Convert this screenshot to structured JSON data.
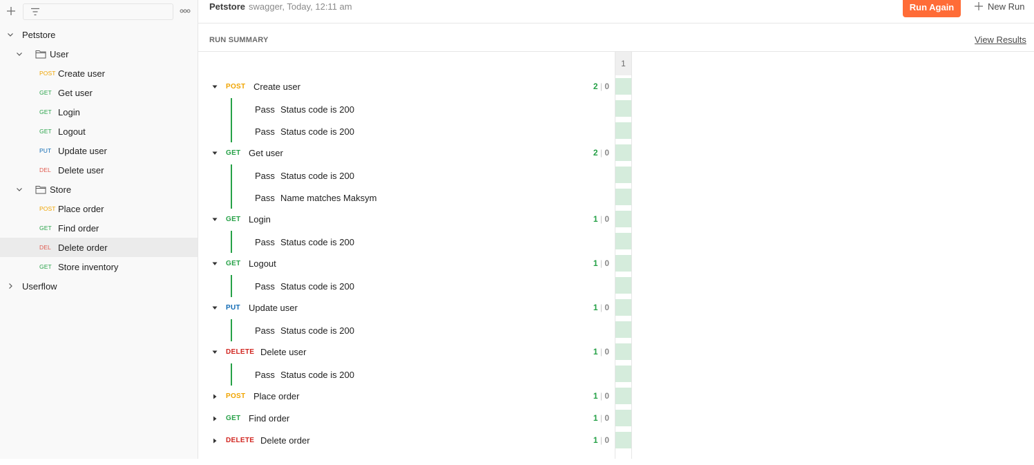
{
  "sidebar": {
    "icons": {
      "add": "plus-icon",
      "filter": "filter-icon",
      "more": "more-horizontal-icon"
    },
    "tree": [
      {
        "type": "collection",
        "label": "Petstore",
        "expanded": true
      },
      {
        "type": "folder",
        "label": "User",
        "expanded": true
      },
      {
        "type": "request",
        "method": "POST",
        "label": "Create user"
      },
      {
        "type": "request",
        "method": "GET",
        "label": "Get user"
      },
      {
        "type": "request",
        "method": "GET",
        "label": "Login"
      },
      {
        "type": "request",
        "method": "GET",
        "label": "Logout"
      },
      {
        "type": "request",
        "method": "PUT",
        "label": "Update user"
      },
      {
        "type": "request",
        "method": "DEL",
        "label": "Delete user"
      },
      {
        "type": "folder",
        "label": "Store",
        "expanded": true
      },
      {
        "type": "request",
        "method": "POST",
        "label": "Place order"
      },
      {
        "type": "request",
        "method": "GET",
        "label": "Find order"
      },
      {
        "type": "request",
        "method": "DEL",
        "label": "Delete order",
        "selected": true
      },
      {
        "type": "request",
        "method": "GET",
        "label": "Store inventory"
      },
      {
        "type": "collection",
        "label": "Userflow",
        "expanded": false
      }
    ]
  },
  "header": {
    "title": "Petstore",
    "meta": "swagger, Today, 12:11 am",
    "run_again_label": "Run Again",
    "new_run_label": "New Run"
  },
  "summary": {
    "label": "RUN SUMMARY",
    "view_results_label": "View Results",
    "iteration_label": "1"
  },
  "results": [
    {
      "method": "POST",
      "name": "Create user",
      "expanded": true,
      "passed": "2",
      "failed": "0",
      "tests": [
        {
          "status": "Pass",
          "name": "Status code is 200"
        },
        {
          "status": "Pass",
          "name": "Status code is 200"
        }
      ]
    },
    {
      "method": "GET",
      "name": "Get user",
      "expanded": true,
      "passed": "2",
      "failed": "0",
      "tests": [
        {
          "status": "Pass",
          "name": "Status code is 200"
        },
        {
          "status": "Pass",
          "name": "Name matches Maksym"
        }
      ]
    },
    {
      "method": "GET",
      "name": "Login",
      "expanded": true,
      "passed": "1",
      "failed": "0",
      "tests": [
        {
          "status": "Pass",
          "name": "Status code is 200"
        }
      ]
    },
    {
      "method": "GET",
      "name": "Logout",
      "expanded": true,
      "passed": "1",
      "failed": "0",
      "tests": [
        {
          "status": "Pass",
          "name": "Status code is 200"
        }
      ]
    },
    {
      "method": "PUT",
      "name": "Update user",
      "expanded": true,
      "passed": "1",
      "failed": "0",
      "tests": [
        {
          "status": "Pass",
          "name": "Status code is 200"
        }
      ]
    },
    {
      "method": "DELETE",
      "name": "Delete user",
      "expanded": true,
      "passed": "1",
      "failed": "0",
      "tests": [
        {
          "status": "Pass",
          "name": "Status code is 200"
        }
      ]
    },
    {
      "method": "POST",
      "name": "Place order",
      "expanded": false,
      "passed": "1",
      "failed": "0",
      "tests": []
    },
    {
      "method": "GET",
      "name": "Find order",
      "expanded": false,
      "passed": "1",
      "failed": "0",
      "tests": []
    },
    {
      "method": "DELETE",
      "name": "Delete order",
      "expanded": false,
      "passed": "1",
      "failed": "0",
      "tests": []
    }
  ],
  "colors": {
    "accent": "#ff6c37",
    "pass": "#26a147",
    "iteration_pass": "#d5ecdc",
    "POST": "#f0a400",
    "GET": "#26a147",
    "PUT": "#0f6ab4",
    "DEL": "#e05a4e",
    "DELETE": "#d1251f"
  }
}
